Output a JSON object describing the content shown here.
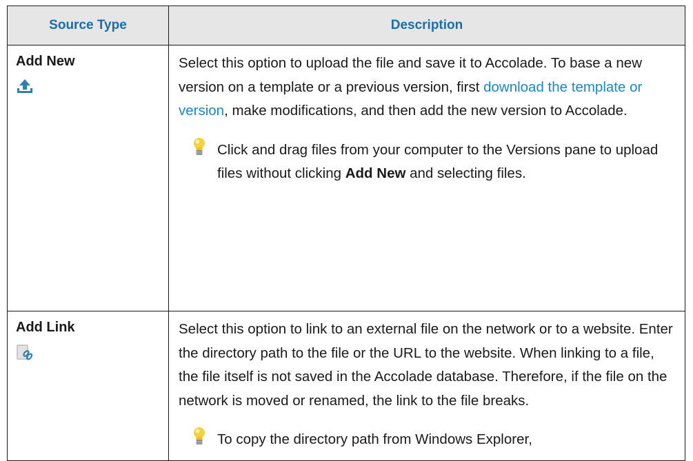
{
  "table": {
    "headers": {
      "source_type": "Source Type",
      "description": "Description"
    },
    "rows": [
      {
        "type": "Add New",
        "icon": "upload-icon",
        "description": {
          "before_link": "Select this option to upload the file and save it to Accolade. To base a new version on a template or a previous version, first ",
          "link": "download the template or version",
          "after_link": ", make modifications, and then add the new version to Accolade."
        },
        "tip": {
          "icon": "lightbulb-icon",
          "before_bold": "Click and drag files from your computer to the Versions pane to upload files without clicking ",
          "bold": "Add New",
          "after_bold": " and selecting files."
        }
      },
      {
        "type": "Add Link",
        "icon": "link-icon",
        "description": {
          "text": "Select this option to link to an external file on the network or to a website. Enter the directory path to the file or the URL to the website. When linking to a file, the file itself is not saved in the Accolade database. Therefore, if the file on the network is moved or renamed, the link to the file breaks."
        },
        "tip": {
          "icon": "lightbulb-icon",
          "text": "To copy the directory path from Windows Explorer,"
        }
      }
    ]
  },
  "colors": {
    "header_text": "#1a6fa8",
    "header_bg": "#e6e6e6",
    "link": "#1a88c9",
    "upload_icon": "#2f7fb0"
  }
}
